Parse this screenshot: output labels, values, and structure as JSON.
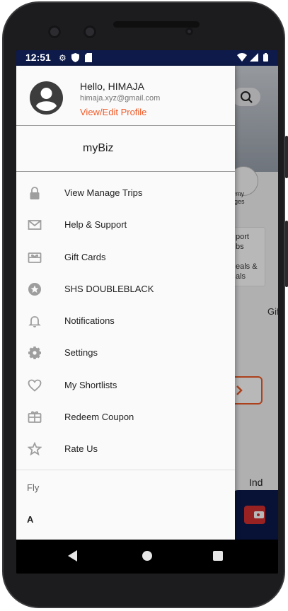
{
  "status_bar": {
    "time": "12:51"
  },
  "background_app": {
    "fragments": [
      "my",
      "ages",
      "port",
      "bs",
      "eals &",
      "als",
      "Gif",
      "Ind"
    ]
  },
  "drawer": {
    "profile": {
      "greeting": "Hello, HIMAJA",
      "email": "himaja.xyz@gmail.com",
      "edit_link": "View/Edit Profile"
    },
    "mybiz_label": "myBiz",
    "menu": [
      {
        "label": "View Manage Trips",
        "icon": "lock-icon"
      },
      {
        "label": "Help & Support",
        "icon": "mail-icon"
      },
      {
        "label": "Gift Cards",
        "icon": "gift-card-icon"
      },
      {
        "label": "SHS DOUBLEBLACK",
        "icon": "star-badge-icon"
      },
      {
        "label": "Notifications",
        "icon": "bell-icon"
      },
      {
        "label": "Settings",
        "icon": "gear-icon"
      },
      {
        "label": "My Shortlists",
        "icon": "heart-icon"
      },
      {
        "label": "Redeem Coupon",
        "icon": "gift-icon"
      },
      {
        "label": "Rate Us",
        "icon": "star-outline-icon"
      }
    ],
    "footer": {
      "fly_label": "Fly",
      "a_label": "A"
    }
  },
  "colors": {
    "accent": "#f05a28",
    "statusbar": "#0e1b4a"
  }
}
